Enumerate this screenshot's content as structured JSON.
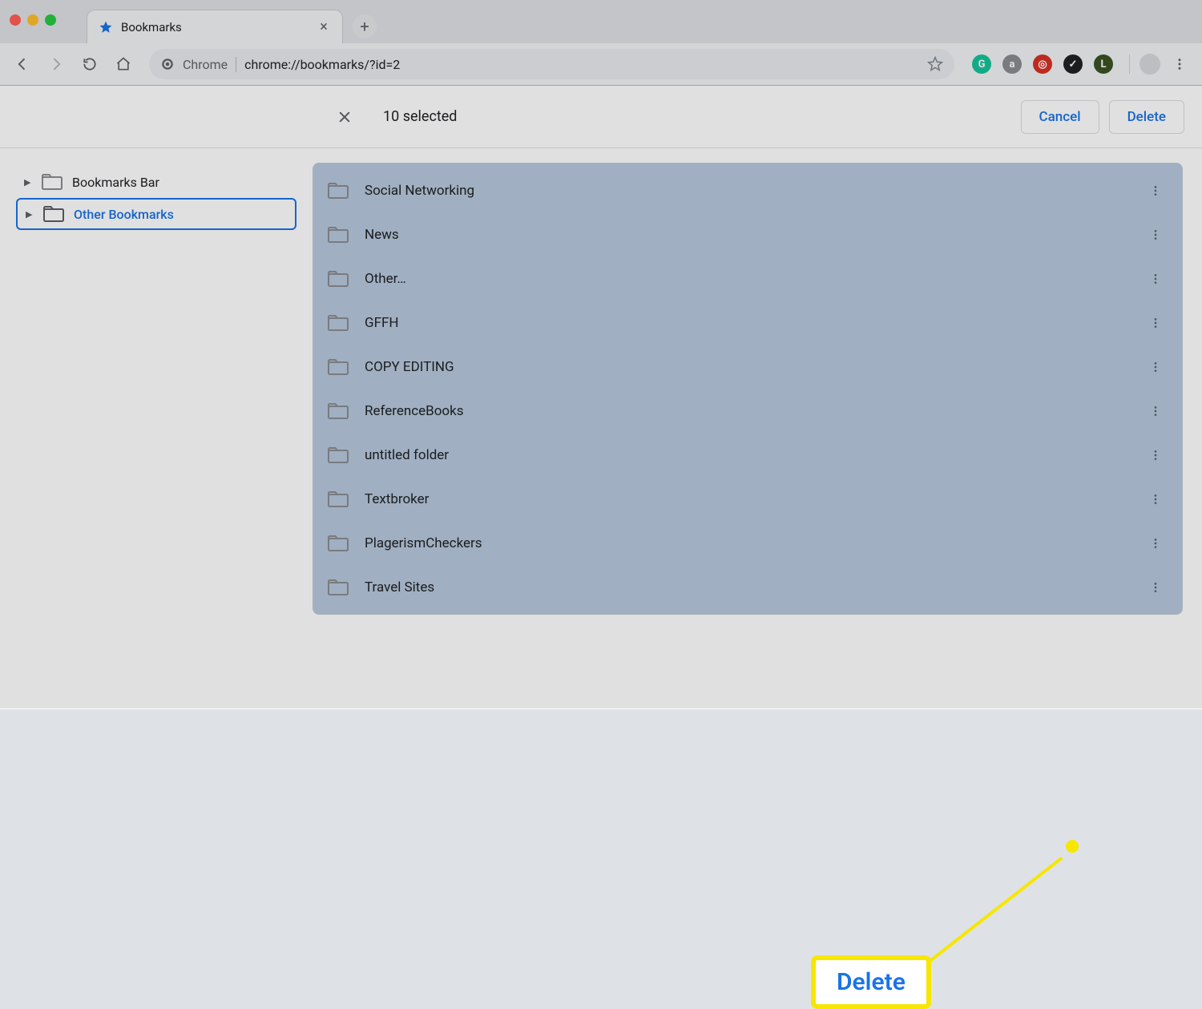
{
  "tab": {
    "title": "Bookmarks"
  },
  "omnibox": {
    "scheme_label": "Chrome",
    "url": "chrome://bookmarks/?id=2"
  },
  "toolbar": {
    "selected_label": "10 selected",
    "cancel": "Cancel",
    "delete": "Delete"
  },
  "sidebar": {
    "items": [
      {
        "label": "Bookmarks Bar",
        "selected": false
      },
      {
        "label": "Other Bookmarks",
        "selected": true
      }
    ]
  },
  "list": {
    "rows": [
      {
        "label": "Social Networking"
      },
      {
        "label": "News"
      },
      {
        "label": "Other…"
      },
      {
        "label": "GFFH"
      },
      {
        "label": "COPY EDITING"
      },
      {
        "label": "ReferenceBooks"
      },
      {
        "label": "untitled folder"
      },
      {
        "label": "Textbroker"
      },
      {
        "label": "PlagerismCheckers"
      },
      {
        "label": "Travel Sites"
      }
    ]
  },
  "extensions": [
    {
      "letter": "G",
      "bg": "#15c39a"
    },
    {
      "letter": "a",
      "bg": "#8a8d91"
    },
    {
      "letter": "◎",
      "bg": "#d93025"
    },
    {
      "letter": "✓",
      "bg": "#202124"
    },
    {
      "letter": "L",
      "bg": "#3b5323"
    }
  ],
  "callout": {
    "label": "Delete"
  }
}
